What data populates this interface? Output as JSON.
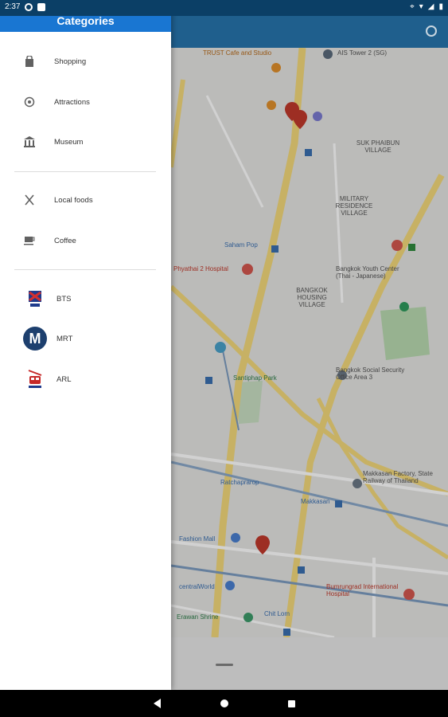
{
  "status_bar": {
    "time": "2:37"
  },
  "drawer": {
    "title": "Categories",
    "groups": [
      {
        "items": [
          {
            "label": "Shopping",
            "icon": "shopping-bag-icon"
          },
          {
            "label": "Attractions",
            "icon": "attractions-icon"
          },
          {
            "label": "Museum",
            "icon": "museum-icon"
          }
        ]
      },
      {
        "items": [
          {
            "label": "Local foods",
            "icon": "fork-knife-icon"
          },
          {
            "label": "Coffee",
            "icon": "coffee-cup-icon"
          }
        ]
      },
      {
        "items": [
          {
            "label": "BTS",
            "icon": "bts-logo-icon"
          },
          {
            "label": "MRT",
            "icon": "mrt-logo-icon"
          },
          {
            "label": "ARL",
            "icon": "arl-logo-icon"
          }
        ]
      }
    ]
  },
  "map": {
    "labels": [
      "TRUST Cafe and Studio",
      "AIS Tower 2 (SG)",
      "SUK PHAIBUN VILLAGE",
      "MILITARY RESIDENCE VILLAGE",
      "Saham Pop",
      "Phyathai 2 Hospital",
      "Bangkok Youth Center (Thai - Japanese)",
      "BANGKOK HOUSING VILLAGE",
      "Santiphap Park",
      "Bangkok Social Security Office Area 3",
      "Makkasan Factory, State Railway of Thailand",
      "Ratchaprarop",
      "Makkasan",
      "Fashion Mall",
      "centralWorld",
      "Bumrungrad International Hospital",
      "Erawan Shrine",
      "Chit Lom"
    ]
  }
}
